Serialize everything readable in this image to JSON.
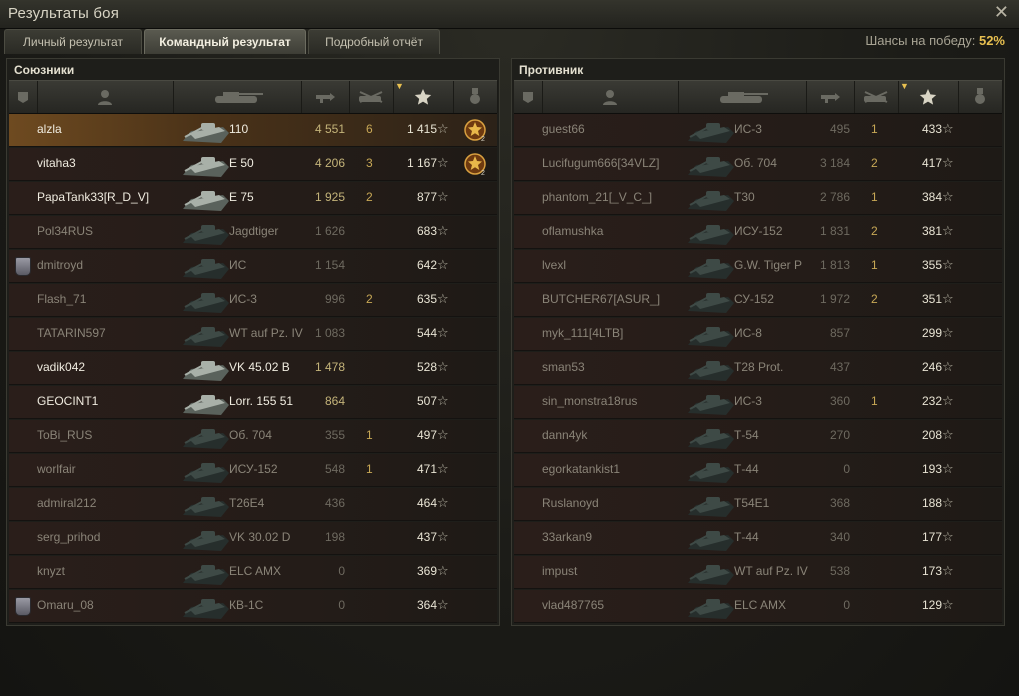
{
  "window": {
    "title": "Результаты боя"
  },
  "tabs": [
    {
      "label": "Личный результат",
      "active": false
    },
    {
      "label": "Командный результат",
      "active": true
    },
    {
      "label": "Подробный отчёт",
      "active": false
    }
  ],
  "win_chance": {
    "label": "Шансы на победу:",
    "value": "52%"
  },
  "allies": {
    "title": "Союзники",
    "rows": [
      {
        "name": "alzla",
        "tank": "110",
        "xp": "4 551",
        "kills": "6",
        "score": "1 415",
        "medal": true,
        "mine": true,
        "bright": true,
        "gold": true,
        "clan": false
      },
      {
        "name": "vitaha3",
        "tank": "E 50",
        "xp": "4 206",
        "kills": "3",
        "score": "1 167",
        "medal": true,
        "mine": false,
        "bright": true,
        "gold": true,
        "clan": false
      },
      {
        "name": "PapaTank33[R_D_V]",
        "tank": "E 75",
        "xp": "1 925",
        "kills": "2",
        "score": "877",
        "medal": false,
        "mine": false,
        "bright": true,
        "gold": true,
        "clan": false
      },
      {
        "name": "Pol34RUS",
        "tank": "Jagdtiger",
        "xp": "1 626",
        "kills": "",
        "score": "683",
        "medal": false,
        "mine": false,
        "bright": false,
        "gold": false,
        "clan": false
      },
      {
        "name": "dmitroyd",
        "tank": "ИС",
        "xp": "1 154",
        "kills": "",
        "score": "642",
        "medal": false,
        "mine": false,
        "bright": false,
        "gold": false,
        "clan": true
      },
      {
        "name": "Flash_71",
        "tank": "ИС-3",
        "xp": "996",
        "kills": "2",
        "score": "635",
        "medal": false,
        "mine": false,
        "bright": false,
        "gold": false,
        "clan": false
      },
      {
        "name": "TATARIN597",
        "tank": "WT auf Pz. IV",
        "xp": "1 083",
        "kills": "",
        "score": "544",
        "medal": false,
        "mine": false,
        "bright": false,
        "gold": false,
        "clan": false
      },
      {
        "name": "vadik042",
        "tank": "VK 45.02 B",
        "xp": "1 478",
        "kills": "",
        "score": "528",
        "medal": false,
        "mine": false,
        "bright": true,
        "gold": true,
        "clan": false
      },
      {
        "name": "GEOCINT1",
        "tank": "Lorr. 155 51",
        "xp": "864",
        "kills": "",
        "score": "507",
        "medal": false,
        "mine": false,
        "bright": true,
        "gold": true,
        "clan": false
      },
      {
        "name": "ToBi_RUS",
        "tank": "Об. 704",
        "xp": "355",
        "kills": "1",
        "score": "497",
        "medal": false,
        "mine": false,
        "bright": false,
        "gold": false,
        "clan": false
      },
      {
        "name": "worlfair",
        "tank": "ИСУ-152",
        "xp": "548",
        "kills": "1",
        "score": "471",
        "medal": false,
        "mine": false,
        "bright": false,
        "gold": false,
        "clan": false
      },
      {
        "name": "admiral212",
        "tank": "T26E4",
        "xp": "436",
        "kills": "",
        "score": "464",
        "medal": false,
        "mine": false,
        "bright": false,
        "gold": false,
        "clan": false
      },
      {
        "name": "serg_prihod",
        "tank": "VK 30.02 D",
        "xp": "198",
        "kills": "",
        "score": "437",
        "medal": false,
        "mine": false,
        "bright": false,
        "gold": false,
        "clan": false
      },
      {
        "name": "knyzt",
        "tank": "ELC AMX",
        "xp": "0",
        "kills": "",
        "score": "369",
        "medal": false,
        "mine": false,
        "bright": false,
        "gold": false,
        "clan": false
      },
      {
        "name": "Omaru_08",
        "tank": "КВ-1С",
        "xp": "0",
        "kills": "",
        "score": "364",
        "medal": false,
        "mine": false,
        "bright": false,
        "gold": false,
        "clan": true
      }
    ]
  },
  "enemies": {
    "title": "Противник",
    "rows": [
      {
        "name": "guest66",
        "tank": "ИС-3",
        "xp": "495",
        "kills": "1",
        "score": "433"
      },
      {
        "name": "Lucifugum666[34VLZ]",
        "tank": "Об. 704",
        "xp": "3 184",
        "kills": "2",
        "score": "417"
      },
      {
        "name": "phantom_21[_V_C_]",
        "tank": "T30",
        "xp": "2 786",
        "kills": "1",
        "score": "384"
      },
      {
        "name": "oflamushka",
        "tank": "ИСУ-152",
        "xp": "1 831",
        "kills": "2",
        "score": "381"
      },
      {
        "name": "lvexl",
        "tank": "G.W. Tiger P",
        "xp": "1 813",
        "kills": "1",
        "score": "355"
      },
      {
        "name": "BUTCHER67[ASUR_]",
        "tank": "СУ-152",
        "xp": "1 972",
        "kills": "2",
        "score": "351"
      },
      {
        "name": "myk_111[4LTB]",
        "tank": "ИС-8",
        "xp": "857",
        "kills": "",
        "score": "299"
      },
      {
        "name": "sman53",
        "tank": "T28 Prot.",
        "xp": "437",
        "kills": "",
        "score": "246"
      },
      {
        "name": "sin_monstra18rus",
        "tank": "ИС-3",
        "xp": "360",
        "kills": "1",
        "score": "232"
      },
      {
        "name": "dann4yk",
        "tank": "Т-54",
        "xp": "270",
        "kills": "",
        "score": "208"
      },
      {
        "name": "egorkatankist1",
        "tank": "Т-44",
        "xp": "0",
        "kills": "",
        "score": "193"
      },
      {
        "name": "Ruslanoyd",
        "tank": "T54E1",
        "xp": "368",
        "kills": "",
        "score": "188"
      },
      {
        "name": "33arkan9",
        "tank": "Т-44",
        "xp": "340",
        "kills": "",
        "score": "177"
      },
      {
        "name": "impust",
        "tank": "WT auf Pz. IV",
        "xp": "538",
        "kills": "",
        "score": "173"
      },
      {
        "name": "vlad487765",
        "tank": "ELC AMX",
        "xp": "0",
        "kills": "",
        "score": "129"
      }
    ]
  },
  "icons": {
    "close": "close-icon",
    "columns": [
      "clan-badge-icon",
      "player-icon",
      "tank-icon",
      "damage-icon",
      "kills-icon",
      "star-icon",
      "medal-icon"
    ]
  },
  "colors": {
    "accent": "#e8c050",
    "own_row": "#6e4a20"
  }
}
